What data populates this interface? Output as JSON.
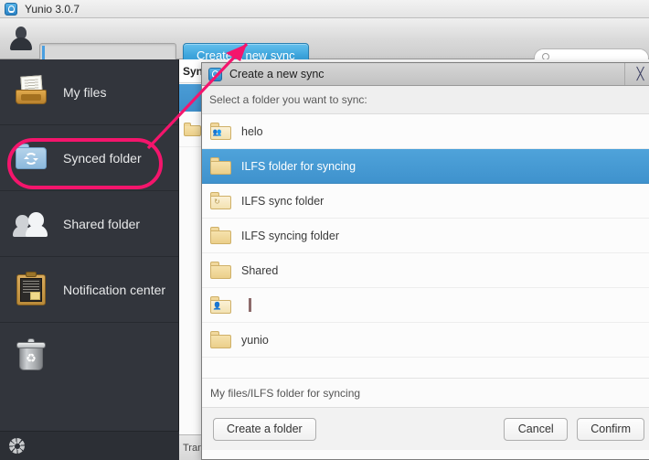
{
  "window": {
    "title": "Yunio 3.0.7",
    "app_icon": "yunio-logo-icon"
  },
  "toolbar": {
    "avatar_icon": "user-avatar-icon",
    "user_field_value": "",
    "user_field_placeholder": "",
    "create_sync_label": "Create a new sync",
    "search_icon": "search-icon",
    "search_value": "",
    "search_placeholder": ""
  },
  "sidebar": {
    "items": [
      {
        "label": "My files",
        "icon": "file-tray-icon"
      },
      {
        "label": "Synced folder",
        "icon": "synced-folder-icon"
      },
      {
        "label": "Shared folder",
        "icon": "two-people-icon"
      },
      {
        "label": "Notification center",
        "icon": "clipboard-icon"
      },
      {
        "label": "",
        "icon": "trash-bin-icon"
      }
    ],
    "settings_icon": "gear-icon"
  },
  "content": {
    "header_title": "Synced folder",
    "status_text": "Transfer",
    "rows": [
      {
        "icon": "folder-sync-icon"
      }
    ]
  },
  "dialog": {
    "title": "Create a new sync",
    "icon": "yunio-logo-icon",
    "close_icon": "close-icon",
    "subtitle": "Select a folder you want to sync:",
    "items": [
      {
        "name": "helo",
        "icon": "folder-shared-icon",
        "badge": "\u0001",
        "selected": false,
        "editing": false
      },
      {
        "name": "ILFS folder for syncing",
        "icon": "folder-icon",
        "badge": "",
        "selected": true,
        "editing": false
      },
      {
        "name": "ILFS sync folder",
        "icon": "folder-sync-icon",
        "badge": "↻",
        "selected": false,
        "editing": false
      },
      {
        "name": "ILFS syncing folder",
        "icon": "folder-icon",
        "badge": "",
        "selected": false,
        "editing": false
      },
      {
        "name": "Shared",
        "icon": "folder-icon",
        "badge": "",
        "selected": false,
        "editing": false
      },
      {
        "name": "",
        "icon": "folder-user-icon",
        "badge": "\u0001",
        "selected": false,
        "editing": true
      },
      {
        "name": "yunio",
        "icon": "folder-icon",
        "badge": "",
        "selected": false,
        "editing": false
      }
    ],
    "path": "My files/ILFS folder for syncing",
    "create_folder_label": "Create a folder",
    "cancel_label": "Cancel",
    "confirm_label": "Confirm"
  },
  "annotations": {
    "highlight_color": "#f4156c",
    "highlight_target": "Synced folder",
    "arrow_target": "Create a new sync"
  }
}
